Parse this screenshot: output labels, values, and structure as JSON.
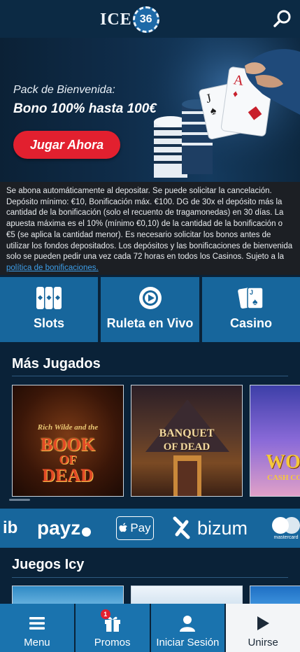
{
  "header": {
    "logo_text": "ICE",
    "logo_number": "36",
    "search_icon": "search-icon"
  },
  "hero": {
    "subtitle": "Pack de Bienvenida:",
    "title": "Bono 100% hasta 100€",
    "cta_label": "Jugar Ahora"
  },
  "terms": {
    "text": "Se abona automáticamente al depositar. Se puede solicitar la cancelación. Depósito mínimo: €10, Bonificación máx. €100. DG de 30x el depósito más la cantidad de la bonificación (solo el recuento de tragamonedas) en 30 días. La apuesta máxima es el 10% (mínimo €0,10) de la cantidad de la bonificación o €5 (se aplica la cantidad menor). Es necesario solicitar los bonos antes de utilizar los fondos depositados. Los depósitos y las bonificaciones de bienvenida solo se pueden pedir una vez cada 72 horas en todos los Casinos. Sujeto a la ",
    "link": "política de bonificaciones."
  },
  "categories": [
    {
      "label": "Slots",
      "icon": "slot-cards-icon"
    },
    {
      "label": "Ruleta en Vivo",
      "icon": "roulette-icon"
    },
    {
      "label": "Casino",
      "icon": "playing-cards-icon"
    }
  ],
  "sections": {
    "most_played": "Más Jugados",
    "icy_games": "Juegos Icy"
  },
  "games": [
    {
      "title_small": "Rich Wilde and the",
      "title_big1": "BOOK",
      "title_big2": "OF",
      "title_big3": "DEAD"
    },
    {
      "title_big1": "BANQUET",
      "title_big2": "OF DEAD"
    },
    {
      "title_big1": "WO",
      "title_big2": "CASH CO"
    }
  ],
  "payments": {
    "partial_left": "ib",
    "payz": "payz",
    "applepay": "Pay",
    "bizum": "bizum",
    "mastercard": "mastercard"
  },
  "bottom_nav": [
    {
      "label": "Menu",
      "icon": "hamburger-icon"
    },
    {
      "label": "Promos",
      "icon": "gift-icon",
      "badge": "1"
    },
    {
      "label": "Iniciar Sesión",
      "icon": "user-icon"
    },
    {
      "label": "Unirse",
      "icon": "play-icon"
    }
  ],
  "colors": {
    "background": "#0a2238",
    "accent_blue": "#17669c",
    "cta_red": "#e2202f",
    "link_blue": "#3d9ee8"
  }
}
